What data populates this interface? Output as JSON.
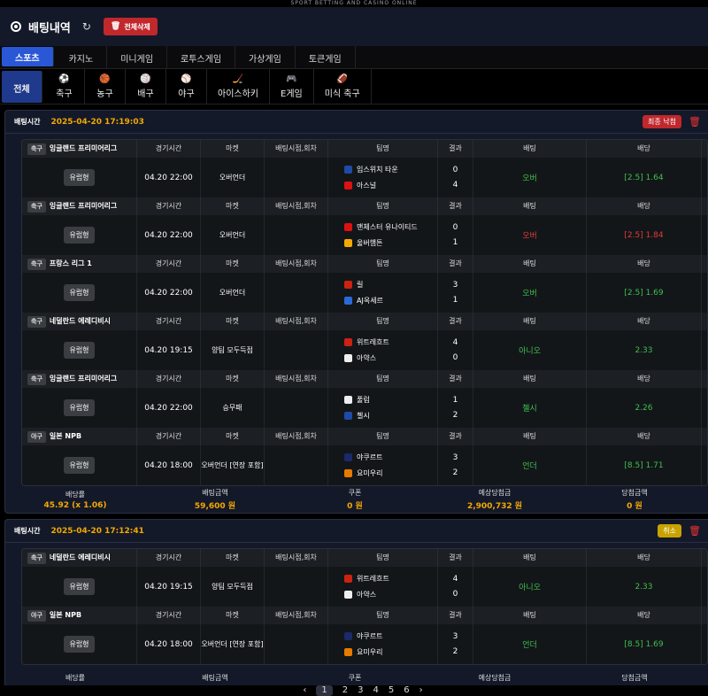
{
  "tagline": "SPORT BETTING AND CASINO ONLINE",
  "header": {
    "title": "배팅내역",
    "delete_all": "전체삭제"
  },
  "tabs": [
    "스포츠",
    "카지노",
    "미니게임",
    "로투스게임",
    "가상게임",
    "토큰게임"
  ],
  "sports": [
    {
      "label": "전체",
      "icon": ""
    },
    {
      "label": "축구",
      "icon": "⚽"
    },
    {
      "label": "농구",
      "icon": "🏀"
    },
    {
      "label": "배구",
      "icon": "🏐"
    },
    {
      "label": "야구",
      "icon": "⚾"
    },
    {
      "label": "아이스하키",
      "icon": "🏒"
    },
    {
      "label": "E게임",
      "icon": "🎮"
    },
    {
      "label": "미식 축구",
      "icon": "🏈"
    }
  ],
  "col_headers": {
    "time": "경기시간",
    "market": "마켓",
    "point": "배팅시점,회차",
    "team": "팀명",
    "result": "결과",
    "bet": "배팅",
    "odds": "배당"
  },
  "summary_labels": [
    "배당률",
    "배팅금액",
    "쿠폰",
    "예상당첨금",
    "당첨금액"
  ],
  "bets": [
    {
      "label": "배팅시간",
      "time": "2025-04-20 17:19:03",
      "status": "최종 낙첨",
      "status_color": "#c0282c",
      "rows": [
        {
          "sport": "축구",
          "league": "잉글랜드 프리미어리그",
          "type": "유럽형",
          "time": "04.20 22:00",
          "market": "오버언더",
          "home": "입스위치 타운",
          "away": "아스널",
          "hs": "0",
          "as": "4",
          "bet": "오버",
          "odds": "[2.5] 1.64",
          "res": "당첨",
          "color": "green",
          "hc": "#1f4aa8",
          "ac": "#d11"
        },
        {
          "sport": "축구",
          "league": "잉글랜드 프리미어리그",
          "type": "유럽형",
          "time": "04.20 22:00",
          "market": "오버언더",
          "home": "맨체스터 유나이티드",
          "away": "울버햄튼",
          "hs": "0",
          "as": "1",
          "bet": "오버",
          "odds": "[2.5] 1.84",
          "res": "낙첨",
          "color": "red",
          "hc": "#d11",
          "ac": "#f2a900"
        },
        {
          "sport": "축구",
          "league": "프랑스 리그 1",
          "type": "유럽형",
          "time": "04.20 22:00",
          "market": "오버언더",
          "home": "릴",
          "away": "AJ옥세르",
          "hs": "3",
          "as": "1",
          "bet": "오버",
          "odds": "[2.5] 1.69",
          "res": "당첨",
          "color": "green",
          "hc": "#c21",
          "ac": "#2a6ad8"
        },
        {
          "sport": "축구",
          "league": "네덜란드 에레디비시",
          "type": "유럽형",
          "time": "04.20 19:15",
          "market": "양팀 모두득점",
          "home": "위트레흐트",
          "away": "아약스",
          "hs": "4",
          "as": "0",
          "bet": "아니오",
          "odds": "2.33",
          "res": "당첨",
          "color": "green",
          "hc": "#c21",
          "ac": "#eee"
        },
        {
          "sport": "축구",
          "league": "잉글랜드 프리미어리그",
          "type": "유럽형",
          "time": "04.20 22:00",
          "market": "승무패",
          "home": "풀럼",
          "away": "첼시",
          "hs": "1",
          "as": "2",
          "bet": "첼시",
          "odds": "2.26",
          "res": "당첨",
          "color": "green",
          "hc": "#eee",
          "ac": "#1f4aa8"
        },
        {
          "sport": "야구",
          "league": "일본 NPB",
          "type": "유럽형",
          "time": "04.20 18:00",
          "market": "오버언더 [연장 포함]",
          "home": "야쿠르트",
          "away": "요미우리",
          "hs": "3",
          "as": "2",
          "bet": "언더",
          "odds": "[8.5] 1.71",
          "res": "당첨",
          "color": "green",
          "hc": "#1a2a6a",
          "ac": "#e87a00"
        }
      ],
      "summary": [
        "45.92 (x 1.06)",
        "59,600 원",
        "0 원",
        "2,900,732 원",
        "0 원"
      ]
    },
    {
      "label": "배팅시간",
      "time": "2025-04-20 17:12:41",
      "status": "취소",
      "status_color": "#c9a200",
      "rows": [
        {
          "sport": "축구",
          "league": "네덜란드 에레디비시",
          "type": "유럽형",
          "time": "04.20 19:15",
          "market": "양팀 모두득점",
          "home": "위트레흐트",
          "away": "아약스",
          "hs": "4",
          "as": "0",
          "bet": "아니오",
          "odds": "2.33",
          "res": "당첨",
          "color": "green",
          "hc": "#c21",
          "ac": "#eee"
        },
        {
          "sport": "야구",
          "league": "일본 NPB",
          "type": "유럽형",
          "time": "04.20 18:00",
          "market": "오버언더 [연장 포함]",
          "home": "야쿠르트",
          "away": "요미우리",
          "hs": "3",
          "as": "2",
          "bet": "언더",
          "odds": "[8.5] 1.69",
          "res": "당첨",
          "color": "green",
          "hc": "#1a2a6a",
          "ac": "#e87a00"
        }
      ],
      "summary": [
        "",
        "",
        "",
        "",
        ""
      ]
    }
  ],
  "pager": [
    "‹",
    "1",
    "2",
    "3",
    "4",
    "5",
    "6",
    "›"
  ]
}
